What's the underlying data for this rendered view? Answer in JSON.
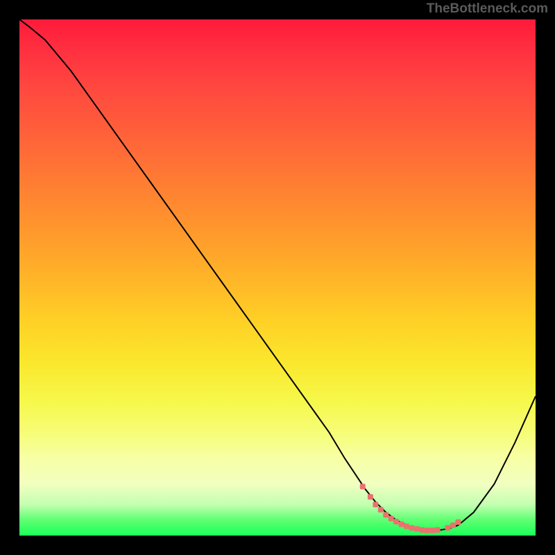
{
  "watermark": "TheBottleneck.com",
  "chart_data": {
    "type": "line",
    "title": "",
    "xlabel": "",
    "ylabel": "",
    "xlim": [
      0,
      100
    ],
    "ylim": [
      0,
      100
    ],
    "series": [
      {
        "name": "bottleneck-curve",
        "x": [
          0,
          2,
          5,
          10,
          15,
          20,
          25,
          30,
          35,
          40,
          45,
          50,
          55,
          60,
          63,
          65,
          67,
          69,
          71,
          73,
          75,
          77,
          79,
          81,
          83,
          85,
          88,
          92,
          96,
          100
        ],
        "y": [
          100,
          98.5,
          96,
          90,
          83,
          76,
          69,
          62,
          55,
          48,
          41,
          34,
          27,
          20,
          15,
          12,
          9,
          6.5,
          4.5,
          3,
          2,
          1.3,
          1,
          1,
          1.3,
          2,
          4.5,
          10,
          18,
          27
        ]
      }
    ],
    "markers": {
      "name": "highlight-range",
      "x": [
        66.5,
        68,
        69,
        70,
        71,
        72,
        73,
        74,
        75,
        76,
        77,
        78,
        79,
        80,
        81,
        83,
        84,
        85
      ],
      "y": [
        9.5,
        7.5,
        6,
        5,
        4,
        3.3,
        2.7,
        2.2,
        1.8,
        1.5,
        1.3,
        1.1,
        1,
        1,
        1.1,
        1.5,
        2.0,
        2.6
      ]
    },
    "background": {
      "type": "vertical-gradient",
      "stops": [
        {
          "pos": 0,
          "color": "#ff1a3a"
        },
        {
          "pos": 50,
          "color": "#ffb428"
        },
        {
          "pos": 80,
          "color": "#f6fd76"
        },
        {
          "pos": 100,
          "color": "#1aff58"
        }
      ]
    }
  }
}
